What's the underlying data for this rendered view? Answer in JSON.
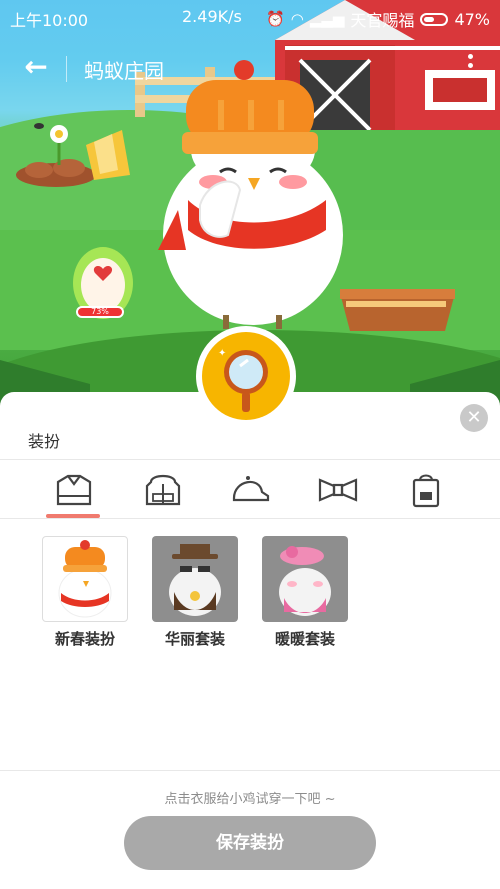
{
  "status_bar": {
    "time": "上午10:00",
    "speed": "2.49K/s",
    "carrier": "天官赐福",
    "battery": "47%"
  },
  "app_bar": {
    "title": "蚂蚁庄园"
  },
  "scene": {
    "egg_progress": "73%"
  },
  "panel": {
    "title": "装扮",
    "tabs": [
      {
        "name": "clothes",
        "selected": true
      },
      {
        "name": "hoodie",
        "selected": false
      },
      {
        "name": "hat",
        "selected": false
      },
      {
        "name": "bowtie",
        "selected": false
      },
      {
        "name": "bag",
        "selected": false
      }
    ],
    "outfits": [
      {
        "label": "新春装扮",
        "selected": true
      },
      {
        "label": "华丽套装",
        "selected": false
      },
      {
        "label": "暖暖套装",
        "selected": false
      }
    ],
    "hint": "点击衣服给小鸡试穿一下吧 ~",
    "save_label": "保存装扮"
  },
  "colors": {
    "accent_underline": "#f07a6e",
    "save_button_disabled": "#a9a9a9",
    "close_button": "#c9c9c9"
  }
}
